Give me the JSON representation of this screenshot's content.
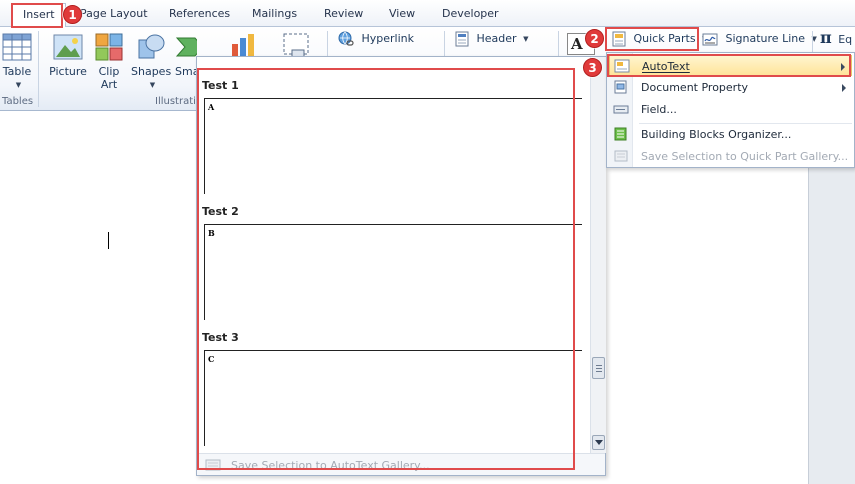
{
  "tabs": [
    {
      "id": "insert",
      "label": "Insert"
    },
    {
      "id": "page-layout",
      "label": "Page Layout"
    },
    {
      "id": "references",
      "label": "References"
    },
    {
      "id": "mailings",
      "label": "Mailings"
    },
    {
      "id": "review",
      "label": "Review"
    },
    {
      "id": "view",
      "label": "View"
    },
    {
      "id": "developer",
      "label": "Developer"
    }
  ],
  "ribbon": {
    "table_label": "Table",
    "tables_group": "Tables",
    "picture_label": "Picture",
    "clip_art_label_1": "Clip",
    "clip_art_label_2": "Art",
    "shapes_label": "Shapes",
    "smartart_label": "Sma",
    "illustrations_group": "Illustrati",
    "hyperlink_label": "Hyperlink",
    "header_label": "Header",
    "quick_parts_label": "Quick Parts",
    "signature_line_label": "Signature Line",
    "equation_label": "Eq",
    "equation_symbol": "π"
  },
  "gallery": {
    "entries": [
      {
        "title": "Test 1",
        "letter": "A"
      },
      {
        "title": "Test 2",
        "letter": "B"
      },
      {
        "title": "Test 3",
        "letter": "C"
      }
    ],
    "footer_label": "Save Selection to AutoText Gallery..."
  },
  "quick_parts_menu": {
    "items": [
      {
        "label": "AutoText",
        "has_submenu": true
      },
      {
        "label": "Document Property",
        "has_submenu": true
      },
      {
        "label": "Field..."
      },
      {
        "label": "Building Blocks Organizer..."
      },
      {
        "label": "Save Selection to Quick Part Gallery..."
      }
    ]
  },
  "badges": {
    "step1": "1",
    "step2": "2",
    "step3": "3"
  },
  "colors": {
    "highlight": "#e04b4b",
    "badge": "#e03a3a",
    "menu_hover": "#ffe49a"
  }
}
